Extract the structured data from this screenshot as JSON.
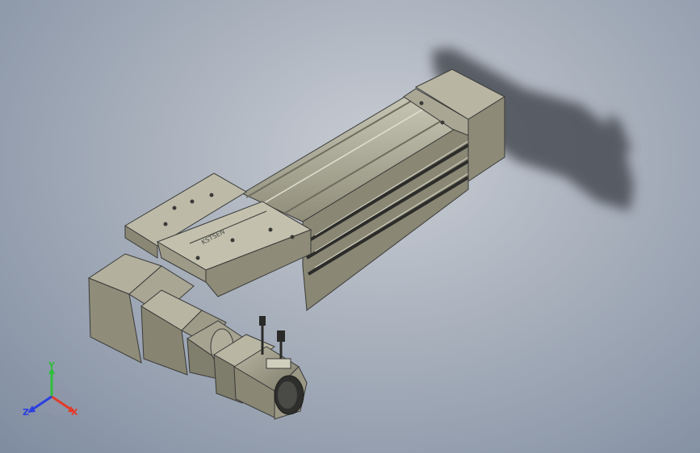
{
  "viewport": {
    "background_top": "#c9cdd4",
    "background_bottom": "#7f8ca0"
  },
  "model": {
    "body_color": "#9c9a86",
    "dark_color": "#3a3a38",
    "shadow_color": "#4a4d55",
    "carriage_label": "KSTSEN"
  },
  "triad": {
    "x_label": "X",
    "y_label": "Y",
    "z_label": "Z",
    "x_color": "#e23b2b",
    "y_color": "#2fbf3a",
    "z_color": "#2b3fe0"
  }
}
